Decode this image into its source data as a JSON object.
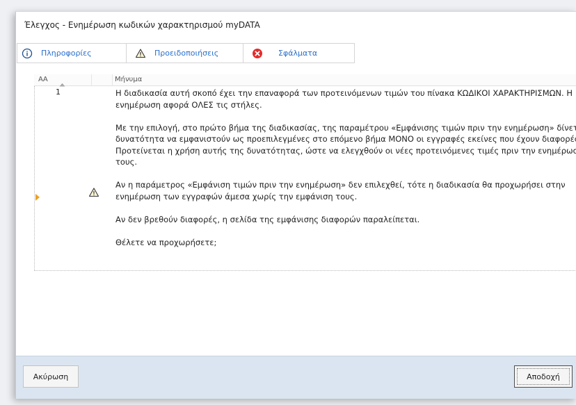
{
  "window": {
    "title": "Έλεγχος - Ενημέρωση κωδικών χαρακτηρισμού myDATA"
  },
  "tabs": [
    {
      "label": "Πληροφορίες",
      "icon": "info-icon"
    },
    {
      "label": "Προειδοποιήσεις",
      "icon": "warning-icon"
    },
    {
      "label": "Σφάλματα",
      "icon": "error-icon"
    }
  ],
  "grid": {
    "columns": {
      "aa": "ΑΑ",
      "message": "Μήνυμα"
    },
    "rows": [
      {
        "aa": "1",
        "icon": "warning-icon",
        "paragraphs": [
          "Η διαδικασία αυτή σκοπό έχει την επαναφορά των προτεινόμενων τιμών του πίνακα ΚΩΔΙΚΟΙ ΧΑΡΑΚΤΗΡΙΣΜΩΝ. Η ενημέρωση αφορά ΟΛΕΣ τις στήλες.",
          "Με την επιλογή, στο πρώτο βήμα της διαδικασίας, της παραμέτρου «Εμφάνισης τιμών πριν την ενημέρωση» δίνεται η δυνατότητα να εμφανιστούν ως προεπιλεγμένες στο επόμενο βήμα ΜΟΝΟ οι εγγραφές εκείνες που έχουν διαφορές. Προτείνεται η χρήση αυτής της δυνατότητας, ώστε να ελεγχθούν οι νέες προτεινόμενες τιμές πριν την ενημέρωση τους.",
          "Αν η παράμετρος «Εμφάνιση τιμών πριν την ενημέρωση» δεν επιλεχθεί, τότε η διαδικασία θα προχωρήσει στην ενημέρωση των εγγραφών άμεσα χωρίς την εμφάνιση τους.",
          "Αν δεν βρεθούν διαφορές, η σελίδα της εμφάνισης διαφορών παραλείπεται.",
          "Θέλετε να προχωρήσετε;"
        ]
      }
    ]
  },
  "footer": {
    "cancel_label": "Ακύρωση",
    "ok_label": "Αποδοχή"
  },
  "colors": {
    "tab_text": "#2a6fcb",
    "footer_bg": "#dbe5f1",
    "error": "#e32b2b",
    "row_indicator": "#f0a020"
  }
}
